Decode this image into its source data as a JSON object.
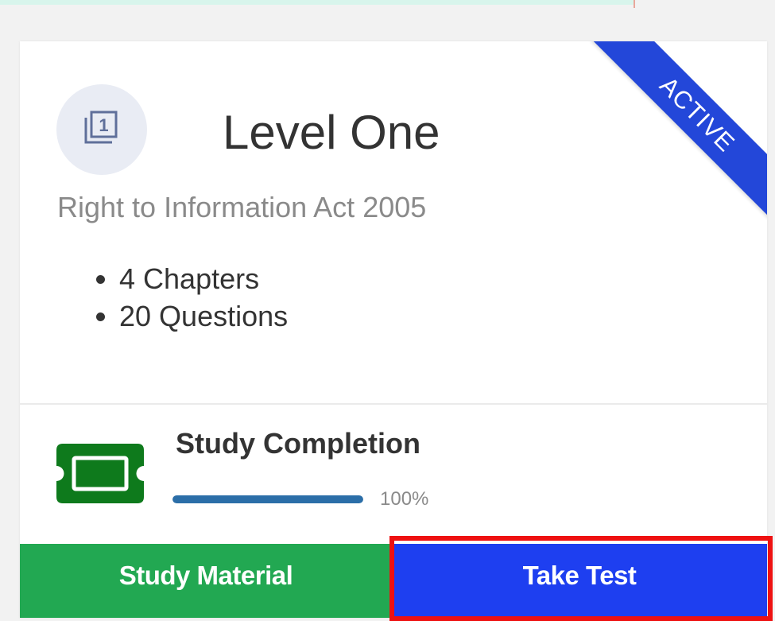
{
  "card": {
    "ribbon_label": "ACTIVE",
    "level_icon": "book-level-one-icon",
    "title": "Level One",
    "subtitle": "Right to Information Act 2005",
    "stats": [
      "4 Chapters",
      "20 Questions"
    ]
  },
  "progress": {
    "icon": "ticket-icon",
    "label": "Study Completion",
    "value": 1.0,
    "percent_text": "100%"
  },
  "actions": {
    "study_material_label": "Study Material",
    "take_test_label": "Take Test"
  },
  "colors": {
    "ribbon": "#2347d9",
    "study_button": "#22a852",
    "test_button": "#1e3ff0",
    "progress_fill": "#2b6ea8",
    "ticket_icon": "#0e7a1c",
    "highlight": "#ee1111"
  }
}
